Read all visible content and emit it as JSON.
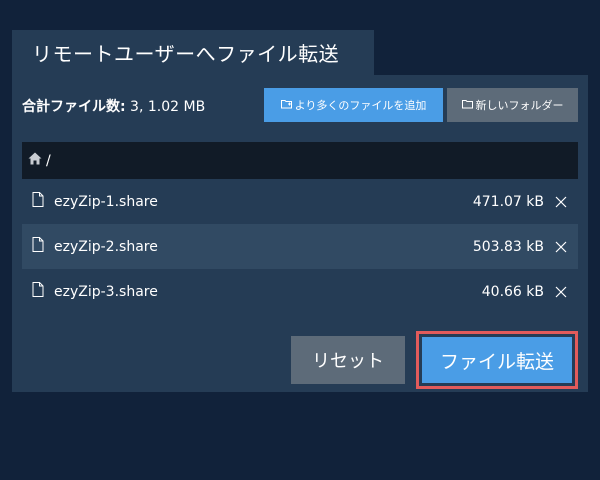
{
  "dialog": {
    "title": "リモートユーザーへファイル転送"
  },
  "summary": {
    "label": "合計ファイル数:",
    "value": " 3, 1.02 MB"
  },
  "toolbar": {
    "add_more_label": "より多くのファイルを追加",
    "new_folder_label": "新しいフォルダー"
  },
  "path": {
    "current": "/"
  },
  "files": [
    {
      "name": "ezyZip-1.share",
      "size": "471.07 kB"
    },
    {
      "name": "ezyZip-2.share",
      "size": "503.83 kB"
    },
    {
      "name": "ezyZip-3.share",
      "size": "40.66 kB"
    }
  ],
  "actions": {
    "reset_label": "リセット",
    "transfer_label": "ファイル転送"
  },
  "colors": {
    "background": "#11223a",
    "panel": "#253c55",
    "row_alt": "#314a63",
    "accent": "#4a9de6",
    "secondary": "#5d6b79",
    "highlight": "#e25b5b"
  }
}
